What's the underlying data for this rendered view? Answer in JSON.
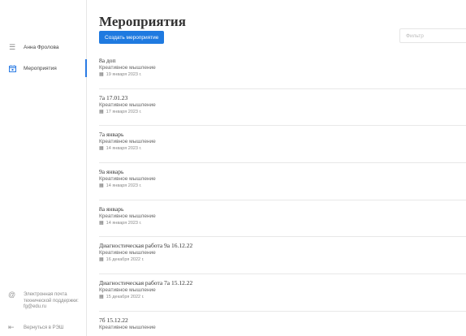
{
  "sidebar": {
    "user_name": "Анна Фролова",
    "events_label": "Мероприятия",
    "support_label": "Электронная почта технической поддержки: fg@edu.ru",
    "back_label": "Вернуться в РЭШ"
  },
  "main": {
    "title": "Мероприятия",
    "create_button": "Создать мероприятие",
    "filter_placeholder": "Фильтр",
    "events": [
      {
        "title": "8а доп",
        "subject": "Креативное мышление",
        "date": "19 января 2023 г."
      },
      {
        "title": "7а 17.01.23",
        "subject": "Креативное мышление",
        "date": "17 января 2023 г."
      },
      {
        "title": "7а январь",
        "subject": "Креативное мышление",
        "date": "14 января 2023 г."
      },
      {
        "title": "9а январь",
        "subject": "Креативное мышление",
        "date": "14 января 2023 г."
      },
      {
        "title": "8а январь",
        "subject": "Креативное мышление",
        "date": "14 января 2023 г."
      },
      {
        "title": "Диагностическая работа 9а 16.12.22",
        "subject": "Креативное мышление",
        "date": "16 декабря 2022 г."
      },
      {
        "title": "Диагностическая работа 7а 15.12.22",
        "subject": "Креативное мышление",
        "date": "15 декабря 2022 г."
      },
      {
        "title": "7б 15.12.22",
        "subject": "Креативное мышление",
        "date": ""
      }
    ]
  },
  "icons": {
    "menu": "menu-icon",
    "calendar": "calendar-icon",
    "at": "at-icon",
    "logout": "logout-icon"
  },
  "colors": {
    "accent": "#1f7ae0"
  }
}
